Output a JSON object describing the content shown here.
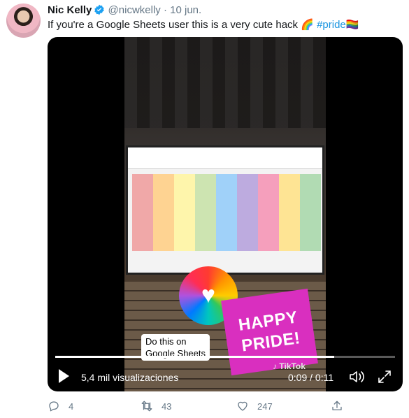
{
  "tweet": {
    "author_name": "Nic Kelly",
    "handle": "@nicwkelly",
    "separator": "·",
    "date": "10 jun.",
    "text_before": "If you're a Google Sheets user this is a very cute hack ",
    "rainbow_emoji": "🌈",
    "hashtag": "#pride",
    "flag_emoji": "🏳️‍🌈",
    "icons": {
      "verified": "verified-badge-icon"
    }
  },
  "video": {
    "caption_line1": "Do this on",
    "caption_line2": "Google Sheets",
    "sticker_line1": "HAPPY",
    "sticker_line2": "PRIDE!",
    "watermark": "TikTok",
    "views": "5,4 mil visualizaciones",
    "time": "0:09 / 0:11",
    "progress": 0.82,
    "colors": {
      "sheet_columns": [
        "#ef9a9a",
        "#ffcc80",
        "#fff59d",
        "#c5e1a5",
        "#90caf9",
        "#b39ddb",
        "#f48fb1",
        "#ffe082",
        "#a5d6a7"
      ]
    }
  },
  "actions": {
    "reply_count": "4",
    "retweet_count": "43",
    "like_count": "247"
  }
}
